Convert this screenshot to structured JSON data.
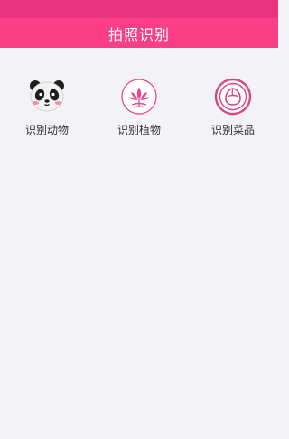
{
  "header": {
    "title": "拍照识别"
  },
  "features": [
    {
      "label": "识别动物",
      "icon": "panda-icon"
    },
    {
      "label": "识别植物",
      "icon": "lotus-icon"
    },
    {
      "label": "识别菜品",
      "icon": "dish-icon"
    }
  ],
  "colors": {
    "status_bar": "#e9337f",
    "header_bg": "#fb3e86",
    "page_bg": "#f3f2f7",
    "accent": "#e54a8e"
  }
}
